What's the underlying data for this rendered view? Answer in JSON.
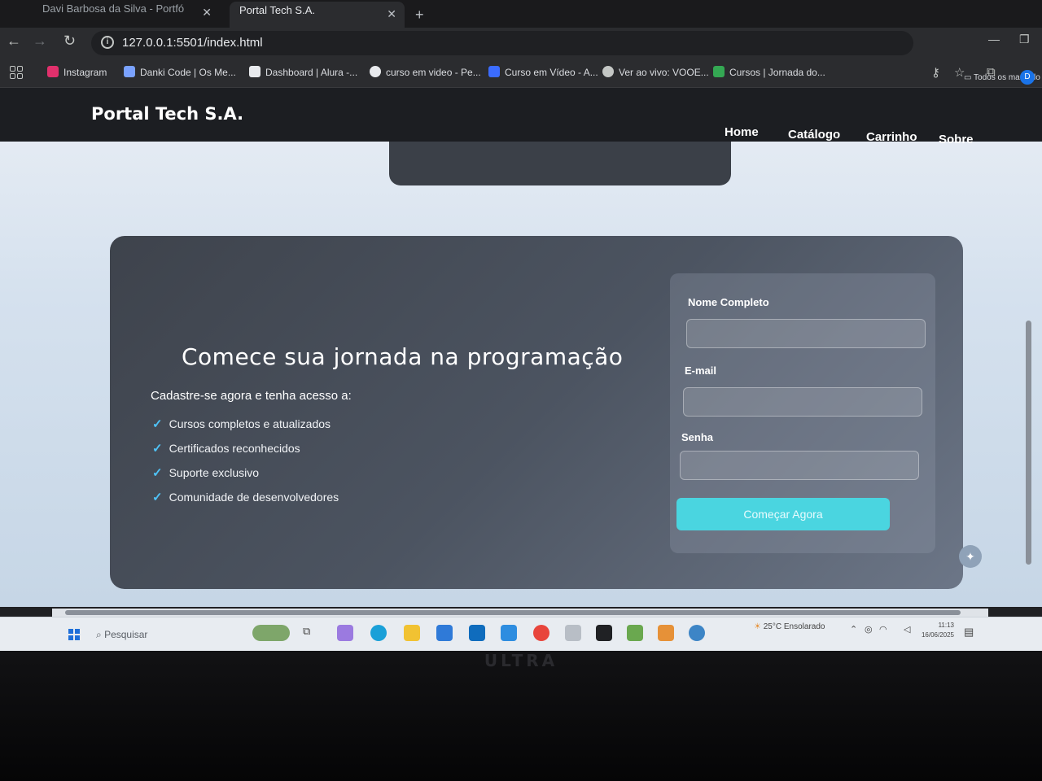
{
  "browser": {
    "tabs": [
      {
        "title": "Davi Barbosa da Silva - Portfó",
        "active": false
      },
      {
        "title": "Portal Tech S.A.",
        "active": true
      }
    ],
    "url": "127.0.0.1:5501/index.html",
    "bookmarks": [
      {
        "label": "Instagram",
        "icon": "instagram-icon",
        "color": "#e1306c"
      },
      {
        "label": "Danki Code | Os Me...",
        "icon": "code-icon",
        "color": "#7aa2ff"
      },
      {
        "label": "Dashboard | Alura -...",
        "icon": "alura-icon",
        "color": "#ffffff"
      },
      {
        "label": "curso em video - Pe...",
        "icon": "google-icon",
        "color": "#ffffff"
      },
      {
        "label": "Curso em Vídeo - A...",
        "icon": "cursoemvideo-icon",
        "color": "#3b6cff"
      },
      {
        "label": "Ver ao vivo: VOOE...",
        "icon": "globe-icon",
        "color": "#c4c7c5"
      },
      {
        "label": "Cursos | Jornada do...",
        "icon": "play-icon",
        "color": "#34a853"
      }
    ],
    "all_bookmarks_label": "Todos os marcado"
  },
  "site": {
    "brand": "Portal Tech S.A.",
    "nav": [
      "Home",
      "Catálogo",
      "Carrinho",
      "Sobre"
    ],
    "hero": {
      "title": "Comece sua jornada na programação",
      "subtitle": "Cadastre-se agora e tenha acesso a:",
      "benefits": [
        "Cursos completos e atualizados",
        "Certificados reconhecidos",
        "Suporte exclusivo",
        "Comunidade de desenvolvedores"
      ]
    },
    "form": {
      "name_label": "Nome Completo",
      "name_value": "",
      "email_label": "E-mail",
      "email_value": "",
      "password_label": "Senha",
      "password_value": "",
      "submit_label": "Começar Agora",
      "accent": "#4ad5e0"
    }
  },
  "taskbar": {
    "search_placeholder": "Pesquisar",
    "weather": "25°C  Ensolarado",
    "time": "11:13",
    "date": "16/06/2025"
  },
  "monitor_brand": "ULTRA"
}
